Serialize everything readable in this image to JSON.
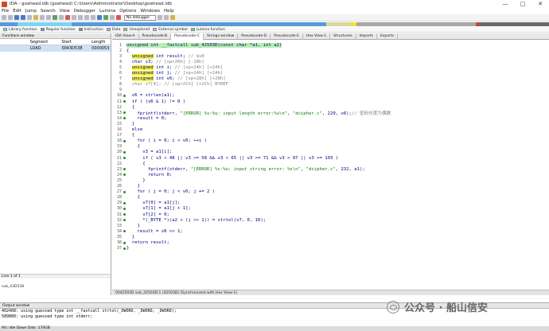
{
  "window": {
    "title": "IDA - goahead.idb (goahead) C:\\Users\\Administrator\\Desktop\\goahead.idb",
    "minimize": "—",
    "maximize": "□",
    "close": "✕"
  },
  "menu": [
    "File",
    "Edit",
    "Jump",
    "Search",
    "View",
    "Debugger",
    "Lumina",
    "Options",
    "Windows",
    "Help"
  ],
  "toolbar": {
    "debugger_select": "No debugger"
  },
  "legend": [
    {
      "label": "Library function",
      "color": "#7fd4f0"
    },
    {
      "label": "Regular function",
      "color": "#5a9ad8"
    },
    {
      "label": "Instruction",
      "color": "#b07a50"
    },
    {
      "label": "Data",
      "color": "#b8b8b8"
    },
    {
      "label": "Unexplored",
      "color": "#a8c870"
    },
    {
      "label": "External symbol",
      "color": "#f0a0f0"
    },
    {
      "label": "Lumina function",
      "color": "#70e070"
    }
  ],
  "functions_window": {
    "title": "Functions window",
    "columns": [
      "Segment",
      "Start",
      "Length"
    ],
    "row": {
      "segment": "LOAD",
      "start": "0043D538",
      "length": "0000053"
    },
    "status": "Line 1 of 1",
    "address": "sub_43D538"
  },
  "tabs": [
    {
      "label": "IDA View-A",
      "active": false
    },
    {
      "label": "Pseudocode-B",
      "active": false
    },
    {
      "label": "Pseudocode-C",
      "active": true
    },
    {
      "label": "Strings window",
      "active": false
    },
    {
      "label": "Pseudocode-D",
      "active": false
    },
    {
      "label": "Pseudocode-E",
      "active": false
    },
    {
      "label": "Hex View-1",
      "active": false
    },
    {
      "label": "Structures",
      "active": false
    },
    {
      "label": "Imports",
      "active": false
    },
    {
      "label": "Exports",
      "active": false
    }
  ],
  "code": {
    "lines": [
      {
        "n": "1",
        "dot": false,
        "parts": [
          {
            "t": "unsigned int __fastcall sub_42503D(const char *a1, int a2)",
            "c": "hl-sig"
          }
        ]
      },
      {
        "n": "2",
        "dot": false,
        "parts": [
          {
            "t": "{"
          }
        ]
      },
      {
        "n": "3",
        "dot": false,
        "parts": [
          {
            "t": "  "
          },
          {
            "t": "unsigned",
            "c": "kw"
          },
          {
            "t": " int result; "
          },
          {
            "t": "// $v0",
            "c": "cm"
          }
        ]
      },
      {
        "n": "4",
        "dot": false,
        "parts": [
          {
            "t": "  char v3; "
          },
          {
            "t": "// [sp+20h] [-18h]",
            "c": "cm"
          }
        ]
      },
      {
        "n": "5",
        "dot": false,
        "parts": [
          {
            "t": "  "
          },
          {
            "t": "unsigned",
            "c": "kw"
          },
          {
            "t": " int i; "
          },
          {
            "t": "// [sp+24h] [+24h]",
            "c": "cm"
          }
        ]
      },
      {
        "n": "6",
        "dot": false,
        "parts": [
          {
            "t": "  "
          },
          {
            "t": "unsigned",
            "c": "kw"
          },
          {
            "t": " int j; "
          },
          {
            "t": "// [sp+24h] [+24h]",
            "c": "cm"
          }
        ]
      },
      {
        "n": "7",
        "dot": false,
        "parts": [
          {
            "t": "  "
          },
          {
            "t": "unsigned",
            "c": "kw"
          },
          {
            "t": " int v6; "
          },
          {
            "t": "// [sp+28h] [+28h]",
            "c": "cm"
          }
        ]
      },
      {
        "n": "8",
        "dot": false,
        "parts": [
          {
            "t": "  char v7[4]; // [sp+2Ch] [+2Ch] BYREF",
            "c": "cm"
          }
        ]
      },
      {
        "n": "9",
        "dot": false,
        "parts": [
          {
            "t": ""
          }
        ]
      },
      {
        "n": "10",
        "dot": true,
        "parts": [
          {
            "t": "  v6 = strlen(a1);"
          }
        ]
      },
      {
        "n": "11",
        "dot": true,
        "parts": [
          {
            "t": "  if ( (v6 & 1) != 0 )"
          }
        ]
      },
      {
        "n": "12",
        "dot": false,
        "parts": [
          {
            "t": "  {"
          }
        ]
      },
      {
        "n": "13",
        "dot": true,
        "parts": [
          {
            "t": "    fprintf(stderr, "
          },
          {
            "t": "\"[ERROR] %s:%u: input length error:%u\\n\"",
            "c": "str"
          },
          {
            "t": ", "
          },
          {
            "t": "\"dcipher.c\"",
            "c": "str"
          },
          {
            "t": ", 220, v6);"
          },
          {
            "t": "// 密码长度为偶数",
            "c": "cm"
          }
        ]
      },
      {
        "n": "14",
        "dot": true,
        "parts": [
          {
            "t": "    result = 0;"
          }
        ]
      },
      {
        "n": "15",
        "dot": false,
        "parts": [
          {
            "t": "  }"
          }
        ]
      },
      {
        "n": "16",
        "dot": false,
        "parts": [
          {
            "t": "  else"
          }
        ]
      },
      {
        "n": "17",
        "dot": false,
        "parts": [
          {
            "t": "  {"
          }
        ]
      },
      {
        "n": "18",
        "dot": true,
        "parts": [
          {
            "t": "    for ( i = 0; i < v6; ++i )"
          }
        ]
      },
      {
        "n": "19",
        "dot": false,
        "parts": [
          {
            "t": "    {"
          }
        ]
      },
      {
        "n": "20",
        "dot": true,
        "parts": [
          {
            "t": "      v3 = a1[i];"
          }
        ]
      },
      {
        "n": "21",
        "dot": true,
        "parts": [
          {
            "t": "      if ( v3 < 48 || v3 >= 58 && v3 < 65 || v3 >= 71 && v3 < 97 || v3 >= 103 )"
          }
        ]
      },
      {
        "n": "22",
        "dot": false,
        "parts": [
          {
            "t": "      {"
          }
        ]
      },
      {
        "n": "23",
        "dot": true,
        "parts": [
          {
            "t": "        fprintf(stderr, "
          },
          {
            "t": "\"[ERROR] %s:%u: input string error: %s\\n\"",
            "c": "str"
          },
          {
            "t": ", "
          },
          {
            "t": "\"dcipher.c\"",
            "c": "str"
          },
          {
            "t": ", 232, a1);"
          }
        ]
      },
      {
        "n": "24",
        "dot": true,
        "parts": [
          {
            "t": "        return 0;"
          }
        ]
      },
      {
        "n": "25",
        "dot": false,
        "parts": [
          {
            "t": "      }"
          }
        ]
      },
      {
        "n": "26",
        "dot": false,
        "parts": [
          {
            "t": "    }"
          }
        ]
      },
      {
        "n": "27",
        "dot": true,
        "parts": [
          {
            "t": "    for ( j = 0; j < v6; j += 2 )"
          }
        ]
      },
      {
        "n": "28",
        "dot": false,
        "parts": [
          {
            "t": "    {"
          }
        ]
      },
      {
        "n": "29",
        "dot": true,
        "parts": [
          {
            "t": "      v7[0] = a1[j];"
          }
        ]
      },
      {
        "n": "30",
        "dot": true,
        "parts": [
          {
            "t": "      v7[1] = a1[j + 1];"
          }
        ]
      },
      {
        "n": "31",
        "dot": true,
        "parts": [
          {
            "t": "      v7[2] = 0;"
          }
        ]
      },
      {
        "n": "32",
        "dot": true,
        "parts": [
          {
            "t": "      *(_BYTE *)(a2 + (j >> 1)) = strtol(v7, 0, 16);"
          }
        ]
      },
      {
        "n": "33",
        "dot": false,
        "parts": [
          {
            "t": "    }"
          }
        ]
      },
      {
        "n": "34",
        "dot": true,
        "parts": [
          {
            "t": "    result = v6 >> 1;"
          }
        ]
      },
      {
        "n": "35",
        "dot": false,
        "parts": [
          {
            "t": "  }"
          }
        ]
      },
      {
        "n": "36",
        "dot": true,
        "parts": [
          {
            "t": "  return result;"
          }
        ]
      },
      {
        "n": "37",
        "dot": true,
        "parts": [
          {
            "t": "}"
          }
        ]
      }
    ],
    "status": "0042503D sub_42503D:1 (42503D) (Synchronized with Hex View-1)"
  },
  "output": {
    "title": "Output window",
    "lines": [
      "402408: using guessed type int __fastcall strtol(_DWORD, _DWORD, _DWORD);",
      "589880: using guessed type int stderr;"
    ]
  },
  "statusbar": "AU:  idle   Down   Disk: 170GB",
  "watermark": "公众号 · 船山信安"
}
